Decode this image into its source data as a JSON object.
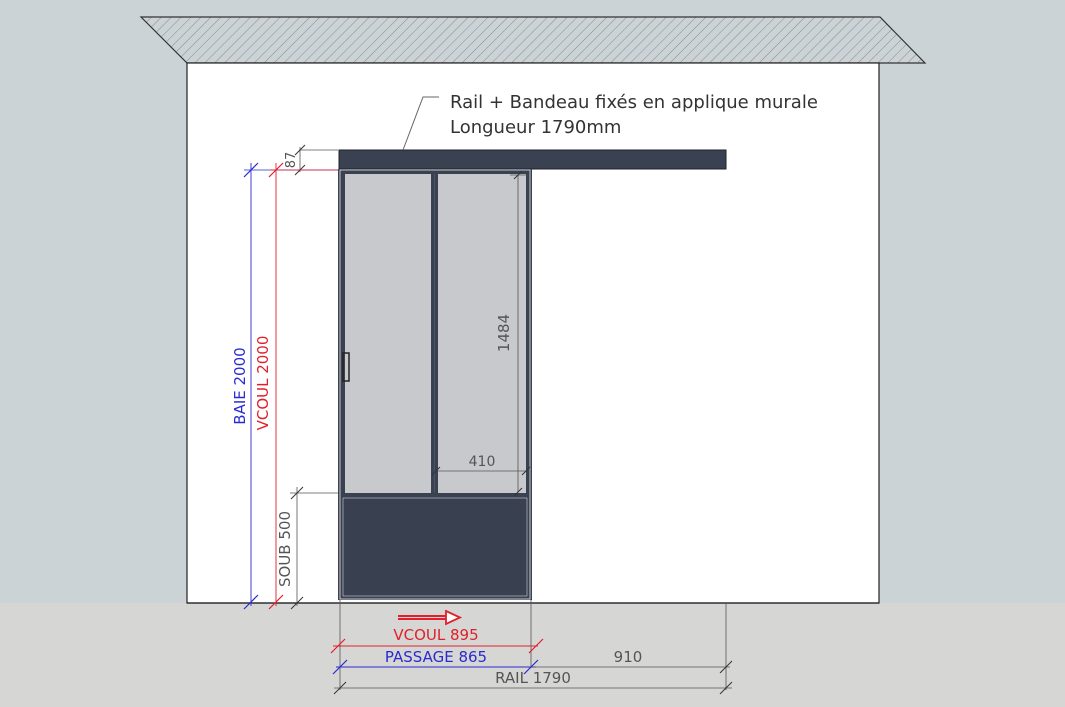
{
  "annotation": {
    "line1": "Rail + Bandeau fixés en applique murale",
    "line2": "Longueur 1790mm"
  },
  "dimensions": {
    "top_gap": "87",
    "baie": "BAIE 2000",
    "vcoul_height": "VCOUL 2000",
    "soub": "SOUB 500",
    "glass_height": "1484",
    "glass_width": "410",
    "vcoul_width": "VCOUL 895",
    "passage": "PASSAGE 865",
    "remaining": "910",
    "rail": "RAIL 1790"
  },
  "colors": {
    "background": "#cbd3d7",
    "floor": "#d6d7d5",
    "wall": "#ffffff",
    "frame": "#3a4150",
    "glass": "#c7c9cd",
    "red": "#e0202a",
    "blue": "#2a2ad0",
    "dim": "#555555"
  },
  "icons": {
    "direction_arrow": "arrow-right-icon"
  }
}
